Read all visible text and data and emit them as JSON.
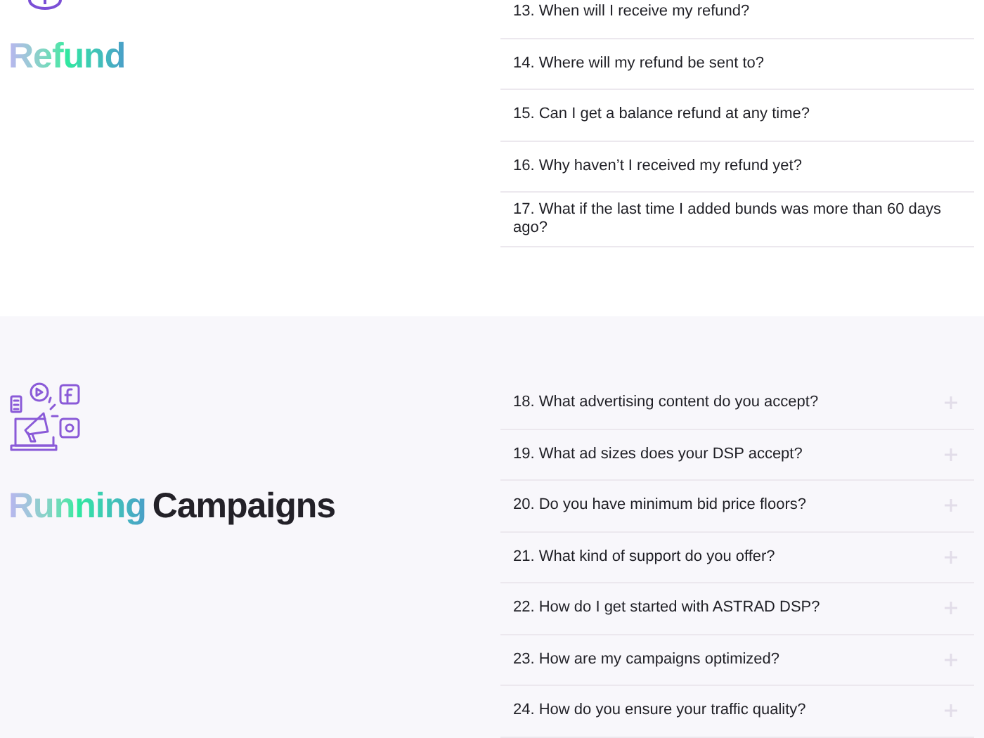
{
  "sections": [
    {
      "title": {
        "highlight": "Refund"
      },
      "questions": [
        {
          "text": "13. When will I receive my refund?"
        },
        {
          "text": "14. Where will my refund be sent to?"
        },
        {
          "text": "15. Can I get a balance refund at any time?"
        },
        {
          "text": "16. Why haven’t I received my refund yet?"
        },
        {
          "text": "17. What if the last time I added bunds was more than 60 days ago?"
        }
      ]
    },
    {
      "title": {
        "highlight": "Running",
        "rest": "Campaigns"
      },
      "questions": [
        {
          "text": "18. What advertising content do you accept?"
        },
        {
          "text": "19. What ad sizes does your DSP accept?"
        },
        {
          "text": "20. Do you have minimum bid price floors?"
        },
        {
          "text": "21. What kind of support do you offer?"
        },
        {
          "text": "22. How do I get started with ASTRAD DSP?"
        },
        {
          "text": "23. How are my campaigns optimized?"
        },
        {
          "text": "24. How do you ensure your traffic quality?"
        }
      ]
    }
  ]
}
